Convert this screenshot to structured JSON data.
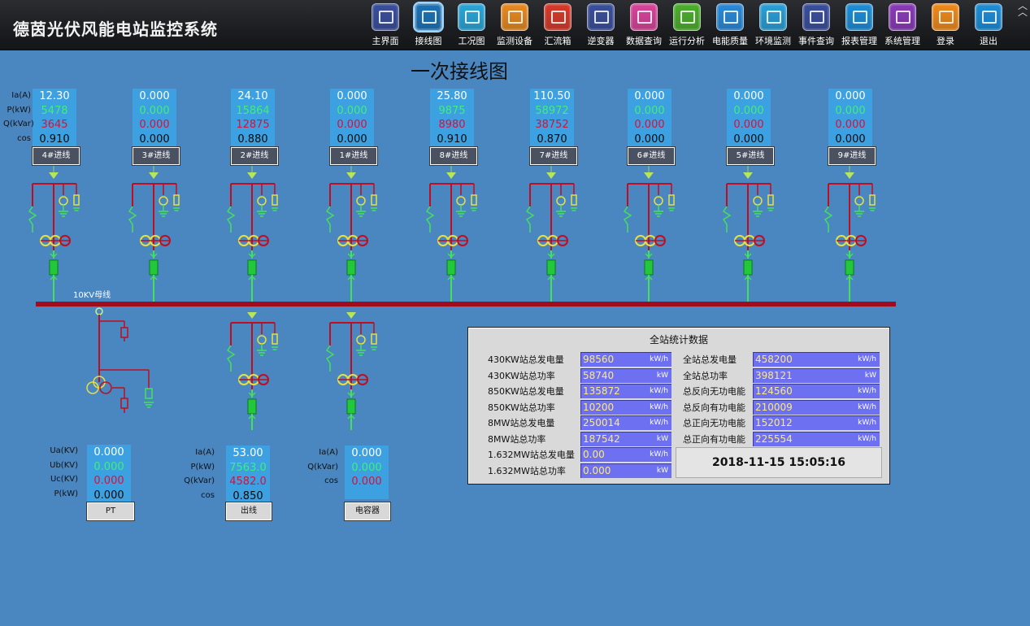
{
  "app": {
    "title": "德茵光伏风能电站监控系统"
  },
  "nav": [
    {
      "label": "主界面",
      "color": "#3a4f9c"
    },
    {
      "label": "接线图",
      "color": "#1b73b8"
    },
    {
      "label": "工况图",
      "color": "#2aa6d8"
    },
    {
      "label": "监测设备",
      "color": "#e88a20"
    },
    {
      "label": "汇流箱",
      "color": "#d73a2a"
    },
    {
      "label": "逆变器",
      "color": "#3a4f9c"
    },
    {
      "label": "数据查询",
      "color": "#d8449a"
    },
    {
      "label": "运行分析",
      "color": "#4caf2c"
    },
    {
      "label": "电能质量",
      "color": "#2a8ad8"
    },
    {
      "label": "环境监测",
      "color": "#2aa0d8"
    },
    {
      "label": "事件查询",
      "color": "#3a4f9c"
    },
    {
      "label": "报表管理",
      "color": "#1d8ed8"
    },
    {
      "label": "系统管理",
      "color": "#8a3ab8"
    },
    {
      "label": "登录",
      "color": "#f08a1a"
    },
    {
      "label": "退出",
      "color": "#1d8ed8"
    }
  ],
  "page": {
    "title": "一次接线图",
    "bus_label": "10KV母线"
  },
  "feeder_labels": [
    "Ia(A)",
    "P(kW)",
    "Q(kVar)",
    "cos"
  ],
  "feeders": [
    {
      "name": "4#进线",
      "ia": "12.30",
      "p": "5478",
      "q": "3645",
      "cos": "0.910"
    },
    {
      "name": "3#进线",
      "ia": "0.000",
      "p": "0.000",
      "q": "0.000",
      "cos": "0.000"
    },
    {
      "name": "2#进线",
      "ia": "24.10",
      "p": "15864",
      "q": "12875",
      "cos": "0.880"
    },
    {
      "name": "1#进线",
      "ia": "0.000",
      "p": "0.000",
      "q": "0.000",
      "cos": "0.000"
    },
    {
      "name": "8#进线",
      "ia": "25.80",
      "p": "9875",
      "q": "8980",
      "cos": "0.910"
    },
    {
      "name": "7#进线",
      "ia": "110.50",
      "p": "58972",
      "q": "38752",
      "cos": "0.870"
    },
    {
      "name": "6#进线",
      "ia": "0.000",
      "p": "0.000",
      "q": "0.000",
      "cos": "0.000"
    },
    {
      "name": "5#进线",
      "ia": "0.000",
      "p": "0.000",
      "q": "0.000",
      "cos": "0.000"
    },
    {
      "name": "9#进线",
      "ia": "0.000",
      "p": "0.000",
      "q": "0.000",
      "cos": "0.000"
    }
  ],
  "pt": {
    "labels": [
      "Ua(KV)",
      "Ub(KV)",
      "Uc(KV)",
      "P(kW)"
    ],
    "ua": "0.000",
    "ub": "0.000",
    "uc": "0.000",
    "p": "0.000",
    "button": "PT"
  },
  "outgoing": {
    "labels": [
      "Ia(A)",
      "P(kW)",
      "Q(kVar)",
      "cos"
    ],
    "ia": "53.00",
    "p": "7563.0",
    "q": "4582.0",
    "cos": "0.850",
    "button": "出线"
  },
  "capacitor": {
    "labels": [
      "Ia(A)",
      "Q(kVar)",
      "cos"
    ],
    "ia": "0.000",
    "q": "0.000",
    "cos": "0.000",
    "button": "电容器"
  },
  "stats": {
    "title": "全站统计数据",
    "left": [
      {
        "label": "430KW站总发电量",
        "value": "98560",
        "unit": "kW/h"
      },
      {
        "label": "430KW站总功率",
        "value": "58740",
        "unit": "kW"
      },
      {
        "label": "850KW站总发电量",
        "value": "135872",
        "unit": "kW/h"
      },
      {
        "label": "850KW站总功率",
        "value": "10200",
        "unit": "kW/h"
      },
      {
        "label": "8MW站总发电量",
        "value": "250014",
        "unit": "kW/h"
      },
      {
        "label": "8MW站总功率",
        "value": "187542",
        "unit": "kW"
      },
      {
        "label": "1.632MW站总发电量",
        "value": "0.00",
        "unit": "kW/h"
      },
      {
        "label": "1.632MW站总功率",
        "value": "0.000",
        "unit": "kW"
      }
    ],
    "right": [
      {
        "label": "全站总发电量",
        "value": "458200",
        "unit": "kW/h"
      },
      {
        "label": "全站总功率",
        "value": "398121",
        "unit": "kW"
      },
      {
        "label": "总反向无功电能",
        "value": "124560",
        "unit": "kW/h"
      },
      {
        "label": "总反向有功电能",
        "value": "210009",
        "unit": "kW/h"
      },
      {
        "label": "总正向无功电能",
        "value": "152012",
        "unit": "kW/h"
      },
      {
        "label": "总正向有功电能",
        "value": "225554",
        "unit": "kW/h"
      }
    ],
    "datetime": "2018-11-15 15:05:16"
  }
}
